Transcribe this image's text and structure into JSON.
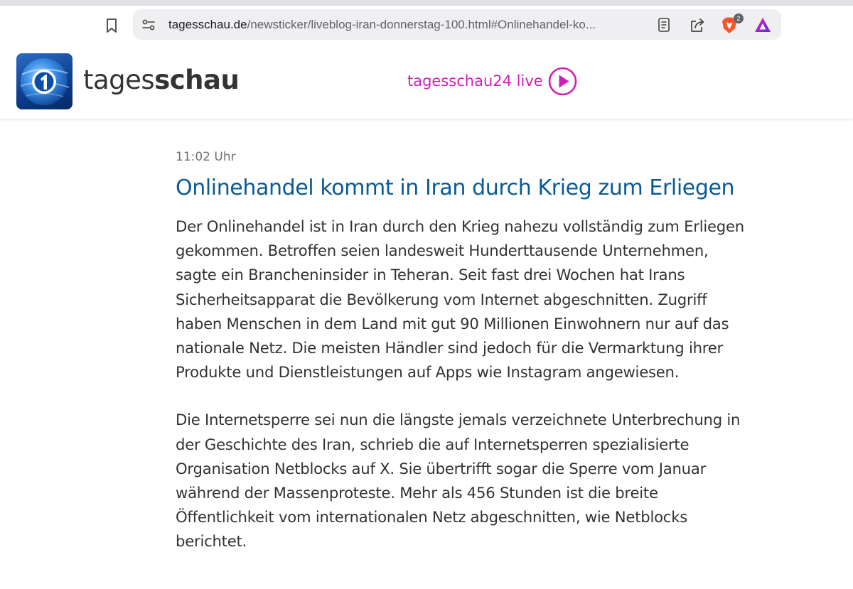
{
  "browser": {
    "url_host": "tagesschau.de",
    "url_path": "/newsticker/liveblog-iran-donnerstag-100.html#Onlinehandel-ko...",
    "brave_badge_count": "2",
    "icons": [
      "bookmark-icon",
      "site-settings-icon",
      "reader-mode-icon",
      "share-icon",
      "brave-shields-icon",
      "brave-rewards-icon"
    ]
  },
  "header": {
    "wordmark_light": "tages",
    "wordmark_bold": "schau",
    "live_label": "tagesschau24 live",
    "colors": {
      "live": "#d01fb8",
      "logo_blue": "#0d3f8f"
    }
  },
  "article": {
    "time": "11:02 Uhr",
    "title": "Onlinehandel kommt in Iran durch Krieg zum Erliegen",
    "paragraphs": [
      [
        "Der Onlinehandel ist in Iran durch den Krieg nahezu vollständig zum Erliegen",
        "gekommen. Betroffen seien landesweit Hunderttausende Unternehmen,",
        "sagte ein Brancheninsider in Teheran. Seit fast drei Wochen hat Irans",
        "Sicherheitsapparat die Bevölkerung vom Internet abgeschnitten. Zugriff",
        "haben Menschen in dem Land mit gut 90 Millionen Einwohnern nur auf das",
        "nationale Netz. Die meisten Händler sind jedoch für die Vermarktung ihrer",
        "Produkte und Dienstleistungen auf Apps wie Instagram angewiesen."
      ],
      [
        "Die Internetsperre sei nun die längste jemals verzeichnete Unterbrechung in",
        "der Geschichte des Iran, schrieb die auf Internetsperren spezialisierte",
        "Organisation Netblocks auf X. Sie übertrifft sogar die Sperre vom Januar",
        "während der Massenproteste. Mehr als 456 Stunden ist die breite",
        "Öffentlichkeit vom internationalen Netz abgeschnitten, wie Netblocks",
        "berichtet."
      ]
    ],
    "colors": {
      "title": "#0a5a94",
      "body": "#333333",
      "time": "#717171"
    }
  }
}
